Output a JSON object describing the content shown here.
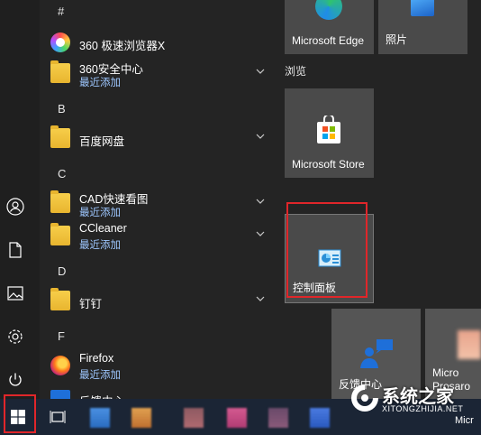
{
  "app_list": {
    "letters": {
      "hash": "#",
      "b": "B",
      "c": "C",
      "d": "D",
      "f": "F"
    },
    "apps": {
      "browser360": {
        "name": "360 极速浏览器X"
      },
      "security360": {
        "name": "360安全中心",
        "sub": "最近添加"
      },
      "baidu": {
        "name": "百度网盘"
      },
      "cad": {
        "name": "CAD快速看图",
        "sub": "最近添加"
      },
      "ccleaner": {
        "name": "CCleaner",
        "sub": "最近添加"
      },
      "dingding": {
        "name": "钉钉"
      },
      "firefox": {
        "name": "Firefox",
        "sub": "最近添加"
      },
      "feedback": {
        "name": "反馈中心"
      }
    }
  },
  "tiles": {
    "edge": "Microsoft Edge",
    "photos": "照片",
    "group_browse": "浏览",
    "store": "Microsoft Store",
    "control_panel": "控制面板",
    "feedback_tile": "反馈中心",
    "partial_tile_1": "Micro",
    "partial_tile_2": "Prosaro",
    "partial_tile_3": "Micr"
  },
  "watermark": {
    "title": "系统之家",
    "subtitle": "XITONGZHIJIA.NET"
  },
  "colors": {
    "accent_red": "#e0262a",
    "link_blue": "#9ec7ff",
    "folder": "#f7ce4a",
    "taskbar": "#1b2535"
  }
}
